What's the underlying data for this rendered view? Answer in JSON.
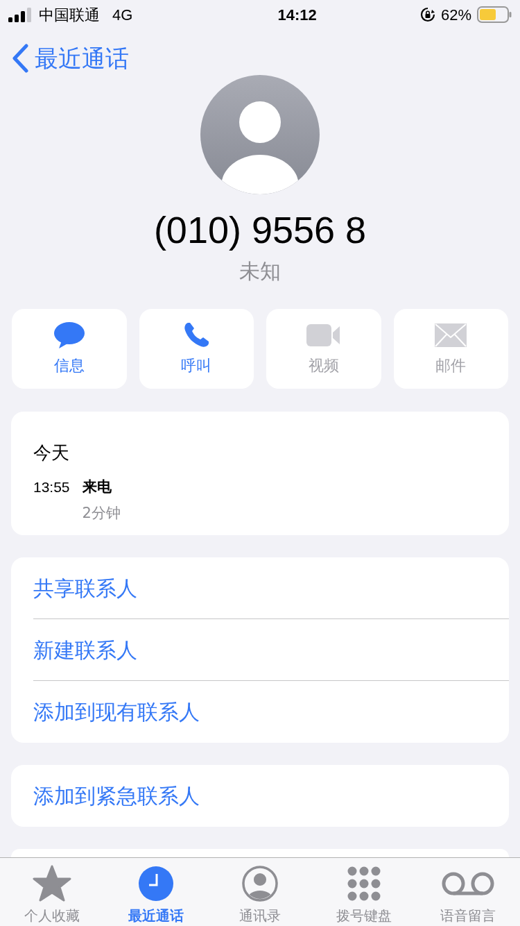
{
  "status_bar": {
    "carrier": "中国联通",
    "network": "4G",
    "time": "14:12",
    "battery": "62%"
  },
  "nav": {
    "back": "最近通话"
  },
  "contact": {
    "number": "(010) 9556 8",
    "label": "未知"
  },
  "actions": [
    {
      "kind": "message",
      "label": "信息",
      "disabled": false
    },
    {
      "kind": "call",
      "label": "呼叫",
      "disabled": false
    },
    {
      "kind": "video",
      "label": "视频",
      "disabled": true
    },
    {
      "kind": "mail",
      "label": "邮件",
      "disabled": true
    }
  ],
  "call_history": {
    "date": "今天",
    "entries": [
      {
        "time": "13:55",
        "type": "来电",
        "duration": "2分钟"
      }
    ]
  },
  "contact_actions": [
    "共享联系人",
    "新建联系人",
    "添加到现有联系人"
  ],
  "emergency_action": "添加到紧急联系人",
  "tabs": [
    {
      "kind": "favorites",
      "label": "个人收藏",
      "selected": false
    },
    {
      "kind": "recents",
      "label": "最近通话",
      "selected": true
    },
    {
      "kind": "contacts",
      "label": "通讯录",
      "selected": false
    },
    {
      "kind": "keypad",
      "label": "拨号键盘",
      "selected": false
    },
    {
      "kind": "voicemail",
      "label": "语音留言",
      "selected": false
    }
  ]
}
